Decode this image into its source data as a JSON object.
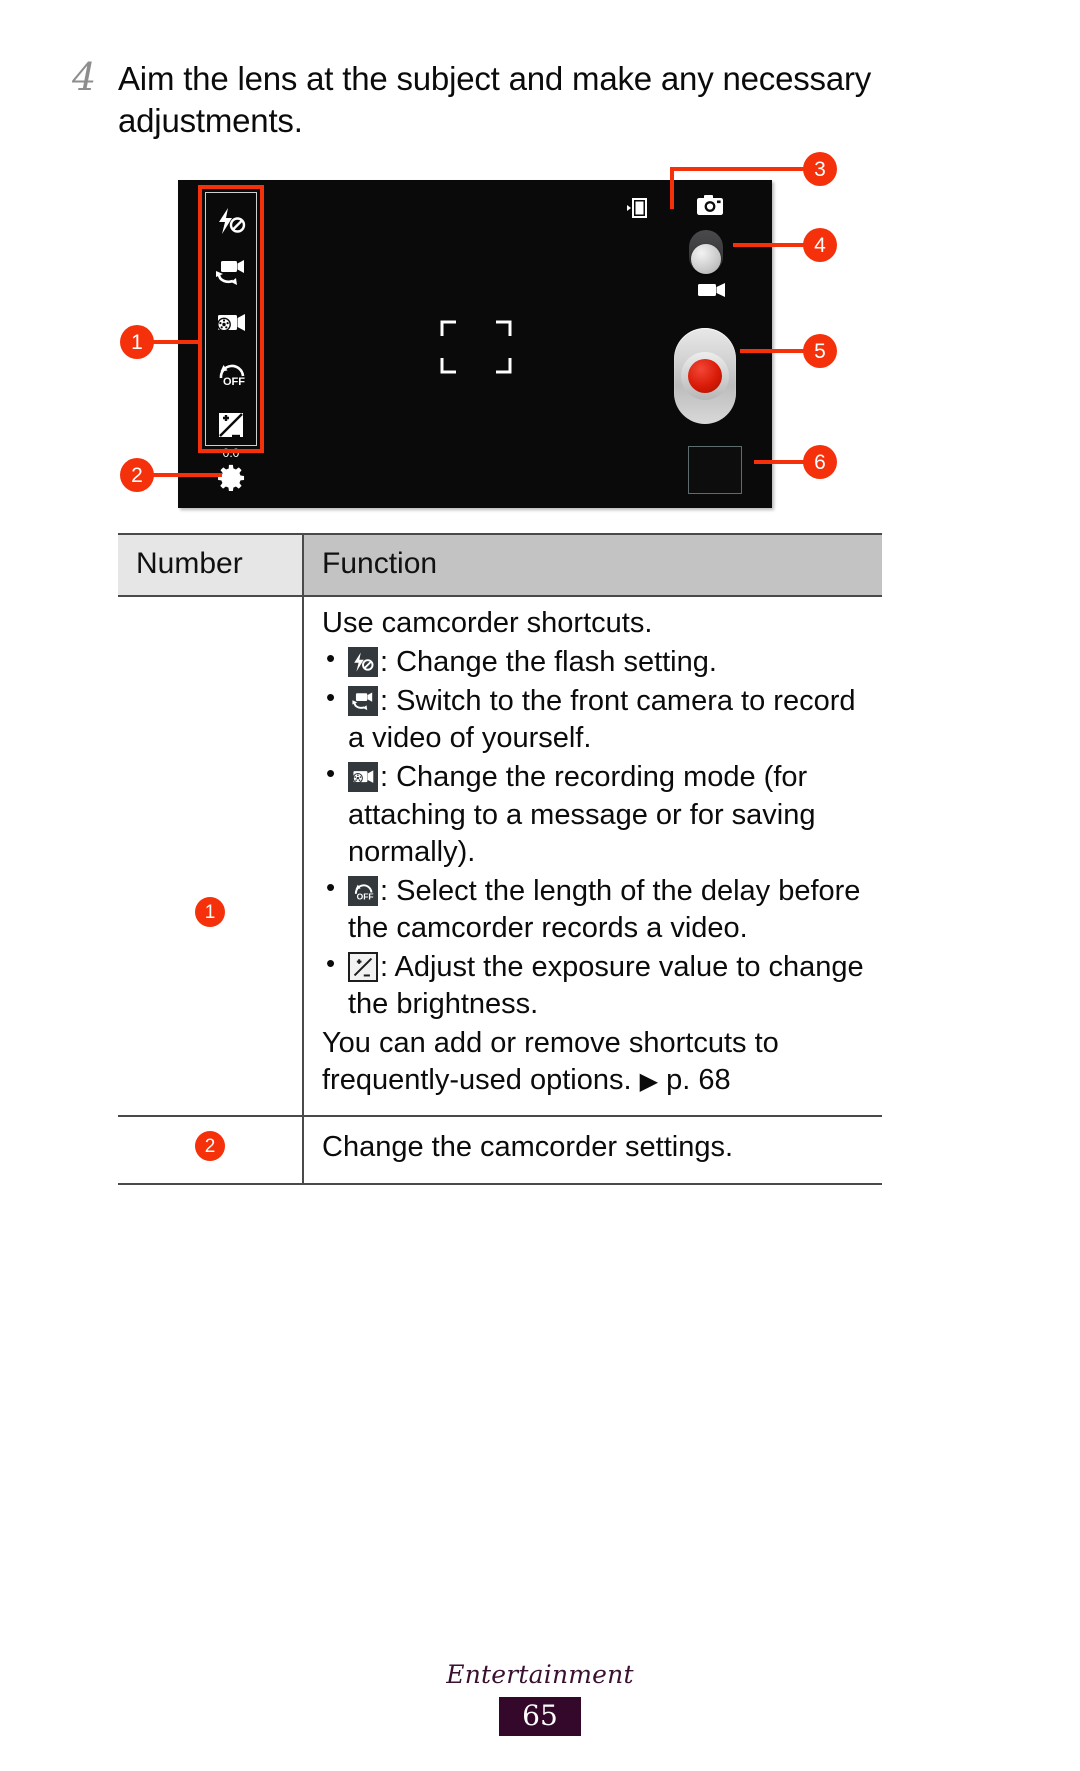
{
  "step": {
    "number": "4",
    "text": "Aim the lens at the subject and make any necessary adjustments."
  },
  "figure": {
    "caption_alt": "Camcorder preview screen",
    "callouts": [
      {
        "id": "1",
        "target": "camcorder-shortcuts-rail"
      },
      {
        "id": "2",
        "target": "camcorder-settings-gear"
      },
      {
        "id": "3",
        "target": "storage-location-indicator"
      },
      {
        "id": "4",
        "target": "camera-camcorder-mode-toggle"
      },
      {
        "id": "5",
        "target": "record-button"
      },
      {
        "id": "6",
        "target": "image-viewer-thumbnail"
      }
    ],
    "rail_icons": [
      {
        "name": "flash-off-icon",
        "label": "Flash"
      },
      {
        "name": "switch-camera-icon",
        "label": "Switch camera"
      },
      {
        "name": "recording-mode-icon",
        "label": "Recording mode"
      },
      {
        "name": "timer-off-icon",
        "label": "OFF"
      },
      {
        "name": "exposure-value-icon",
        "label": "0.0"
      }
    ],
    "exposure_value": "0.0",
    "timer_value": "OFF",
    "status_icons": [
      {
        "name": "storage-location-icon"
      },
      {
        "name": "camera-icon"
      }
    ],
    "accent_color": "#f4310b"
  },
  "table": {
    "headers": {
      "number": "Number",
      "function": "Function"
    },
    "rows": [
      {
        "number": "1",
        "intro": "Use camcorder shortcuts.",
        "bullets": [
          {
            "icon": "flash-off-icon",
            "text": ": Change the flash setting."
          },
          {
            "icon": "switch-camera-icon",
            "text": ": Switch to the front camera to record a video of yourself."
          },
          {
            "icon": "recording-mode-icon",
            "text": ": Change the recording mode (for attaching to a message or for saving normally)."
          },
          {
            "icon": "timer-off-icon",
            "text": ": Select the length of the delay before the camcorder records a video."
          },
          {
            "icon": "exposure-value-icon",
            "text": ": Adjust the exposure value to change the brightness."
          }
        ],
        "outro_before": "You can add or remove shortcuts to frequently-used options.",
        "outro_marker": "▶",
        "outro_after": "p. 68"
      },
      {
        "number": "2",
        "text": "Change the camcorder settings."
      }
    ]
  },
  "footer": {
    "section": "Entertainment",
    "page": "65"
  }
}
